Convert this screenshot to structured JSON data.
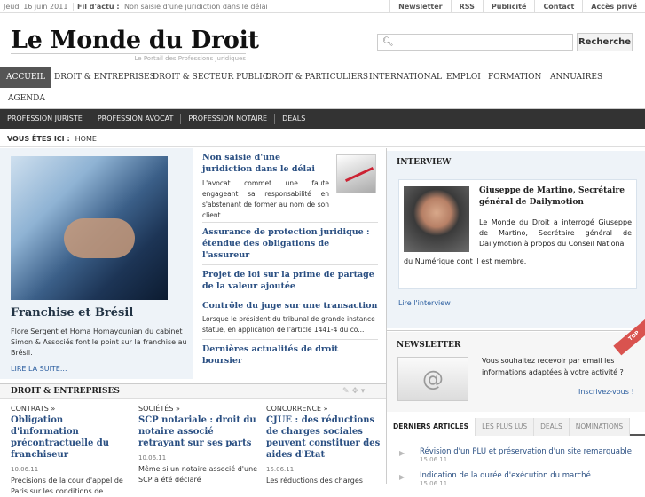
{
  "topbar": {
    "date": "Jeudi 16 juin 2011",
    "fil_label": "Fil d'actu :",
    "fil_text": "Non saisie d'une juridiction dans le délai",
    "links": [
      "Newsletter",
      "RSS",
      "Publicité",
      "Contact",
      "Accès privé"
    ]
  },
  "site": {
    "title": "Le Monde du Droit",
    "tagline": "Le Portail des Professions Juridiques"
  },
  "search": {
    "placeholder": "",
    "button": "Recherche"
  },
  "main_nav": [
    "ACCUEIL",
    "DROIT & ENTREPRISES",
    "DROIT & SECTEUR PUBLIC",
    "DROIT & PARTICULIERS",
    "INTERNATIONAL",
    "EMPLOI",
    "FORMATION",
    "ANNUAIRES",
    "AGENDA"
  ],
  "sub_nav": [
    "PROFESSION JURISTE",
    "PROFESSION AVOCAT",
    "PROFESSION NOTAIRE",
    "DEALS"
  ],
  "breadcrumb": {
    "label": "VOUS ÊTES ICI :",
    "current": "HOME"
  },
  "feature": {
    "title": "Franchise et Brésil",
    "text": "Flore Sergent et Homa Homayounian du cabinet Simon & Associés font le point sur la franchise au Brésil.",
    "more": "LIRE LA SUITE..."
  },
  "news": [
    {
      "title": "Non saisie d'une juridiction dans le délai",
      "text": "L'avocat commet une faute engageant sa responsabilité en s'abstenant de former au nom de son client ..."
    },
    {
      "title": "Assurance de protection juridique : étendue des obligations de l'assureur",
      "text": ""
    },
    {
      "title": "Projet de loi sur la prime de partage de la valeur ajoutée",
      "text": ""
    },
    {
      "title": "Contrôle du juge sur une transaction",
      "text": "Lorsque le président du tribunal de grande instance statue, en application de l'article 1441-4 du co..."
    },
    {
      "title": "Dernières actualités de droit boursier",
      "text": ""
    }
  ],
  "droit_section": {
    "heading": "DROIT & ENTREPRISES",
    "tools": "✎ ✥ ▾",
    "columns": [
      {
        "category": "CONTRATS »",
        "title": "Obligation d'information précontractuelle du franchiseur",
        "date": "10.06.11",
        "text": "Précisions de la cour d'appel de Paris sur les conditions de"
      },
      {
        "category": "SOCIÉTÉS »",
        "title": "SCP notariale : droit du notaire associé retrayant sur ses parts",
        "date": "10.06.11",
        "text": "Même si un notaire associé d'une SCP a été déclaré"
      },
      {
        "category": "CONCURRENCE »",
        "title": "CJUE : des réductions de charges sociales peuvent constituer des aides d'Etat",
        "date": "15.06.11",
        "text": "Les réductions des charges"
      }
    ]
  },
  "interview": {
    "heading": "INTERVIEW",
    "name": "Giuseppe de Martino, Secrétaire général de Dailymotion",
    "text1": "Le Monde du Droit a interrogé Giuseppe de Martino, Secrétaire général de Dailymotion à propos du Conseil National",
    "text2": "du Numérique dont il est membre.",
    "link": "Lire l'interview"
  },
  "newsletter": {
    "heading": "NEWSLETTER",
    "text": "Vous souhaitez recevoir par email les informations adaptées à votre activité ?",
    "link": "Inscrivez-vous !",
    "ribbon": "TOP"
  },
  "tabs": [
    "DERNIERS ARTICLES",
    "LES PLUS LUS",
    "DEALS",
    "NOMINATIONS"
  ],
  "latest": [
    {
      "title": "Révision d'un PLU et préservation d'un site remarquable",
      "date": "15.06.11"
    },
    {
      "title": "Indication de la durée d'exécution du marché",
      "date": "15.06.11"
    }
  ],
  "icons": {
    "search": "magnifier-icon",
    "bullet": "arrow-bullet-icon"
  },
  "colors": {
    "link": "#2a4f82",
    "accent": "#555555",
    "subnav": "#333333",
    "ribbon": "#d9534f"
  }
}
